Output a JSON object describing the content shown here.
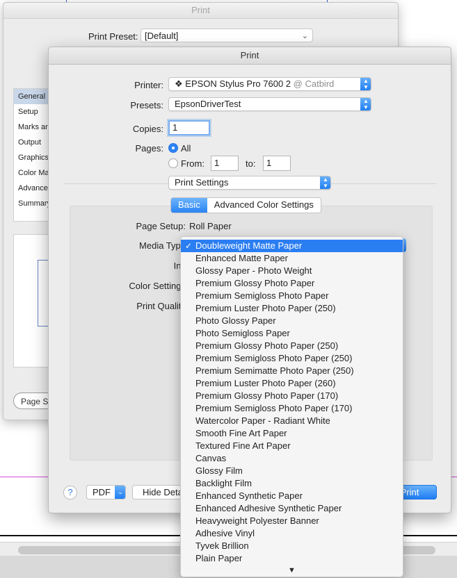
{
  "back_dialog": {
    "title": "Print",
    "preset_label": "Print Preset:",
    "preset_value": "[Default]",
    "sidebar_items": [
      "General",
      "Setup",
      "Marks and Bleed",
      "Output",
      "Graphics",
      "Color Management",
      "Advanced",
      "Summary"
    ],
    "page_setup_button": "Page Setup..."
  },
  "dialog": {
    "title": "Print",
    "printer_label": "Printer:",
    "printer_name": "EPSON Stylus Pro 7600 2",
    "printer_host": "@ Catbird",
    "presets_label": "Presets:",
    "presets_value": "EpsonDriverTest",
    "copies_label": "Copies:",
    "copies_value": "1",
    "pages_label": "Pages:",
    "pages_all": "All",
    "pages_from": "From:",
    "from_value": "1",
    "pages_to": "to:",
    "to_value": "1",
    "section_popup": "Print Settings",
    "tabs": [
      "Basic",
      "Advanced Color Settings"
    ],
    "page_setup_label": "Page Setup:",
    "page_setup_value": "Roll Paper",
    "media_type_label": "Media Type",
    "ink_label": "Ink",
    "color_settings_label": "Color Settings",
    "print_quality_label": "Print Quality",
    "help": "?",
    "pdf_button": "PDF",
    "hide_details_button": "Hide Details",
    "print_button": "Print"
  },
  "media_menu": {
    "selected": "Doubleweight Matte Paper",
    "items": [
      "Doubleweight Matte Paper",
      "Enhanced Matte Paper",
      "Glossy Paper - Photo Weight",
      "Premium Glossy Photo Paper",
      "Premium Semigloss Photo Paper",
      "Premium Luster Photo Paper (250)",
      "Photo Glossy Paper",
      "Photo Semigloss Paper",
      "Premium Glossy Photo Paper (250)",
      "Premium Semigloss Photo Paper (250)",
      "Premium Semimatte Photo Paper (250)",
      "Premium Luster Photo Paper (260)",
      "Premium Glossy Photo Paper (170)",
      "Premium Semigloss Photo Paper (170)",
      "Watercolor Paper - Radiant White",
      "Smooth Fine Art Paper",
      "Textured Fine Art Paper",
      "Canvas",
      "Glossy Film",
      "Backlight Film",
      "Enhanced Synthetic Paper",
      "Enhanced Adhesive Synthetic Paper",
      "Heavyweight Polyester Banner",
      "Adhesive Vinyl",
      "Tyvek Brillion",
      "Plain Paper"
    ],
    "check_icon": "checkmark-icon",
    "scroll_icon": "scroll-down-arrow-icon"
  },
  "colors": {
    "accent": "#2b7ef2",
    "dialog_bg": "#ececec"
  }
}
